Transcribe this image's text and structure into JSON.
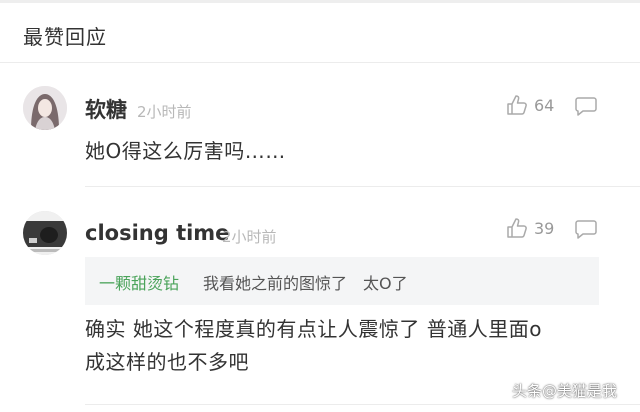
{
  "section": {
    "title": "最赞回应"
  },
  "comments": [
    {
      "username": "软糖",
      "time": "2小时前",
      "likes": "64",
      "text": "她O得这么厉害吗……"
    },
    {
      "username": "closing time",
      "time": "2小时前",
      "likes": "39",
      "quote": {
        "author": "一颗甜烫钻",
        "text": "我看她之前的图惊了　太O了"
      },
      "text_line1": "确实 她这个程度真的有点让人震惊了 普通人里面o",
      "text_line2": "成这样的也不多吧"
    }
  ],
  "icons": {
    "like": "thumbs-up-icon",
    "reply": "comment-bubble-icon"
  },
  "colors": {
    "quote_author": "#4aa35a",
    "muted": "#b8b8b8"
  },
  "watermark": "头条@美猫是我"
}
